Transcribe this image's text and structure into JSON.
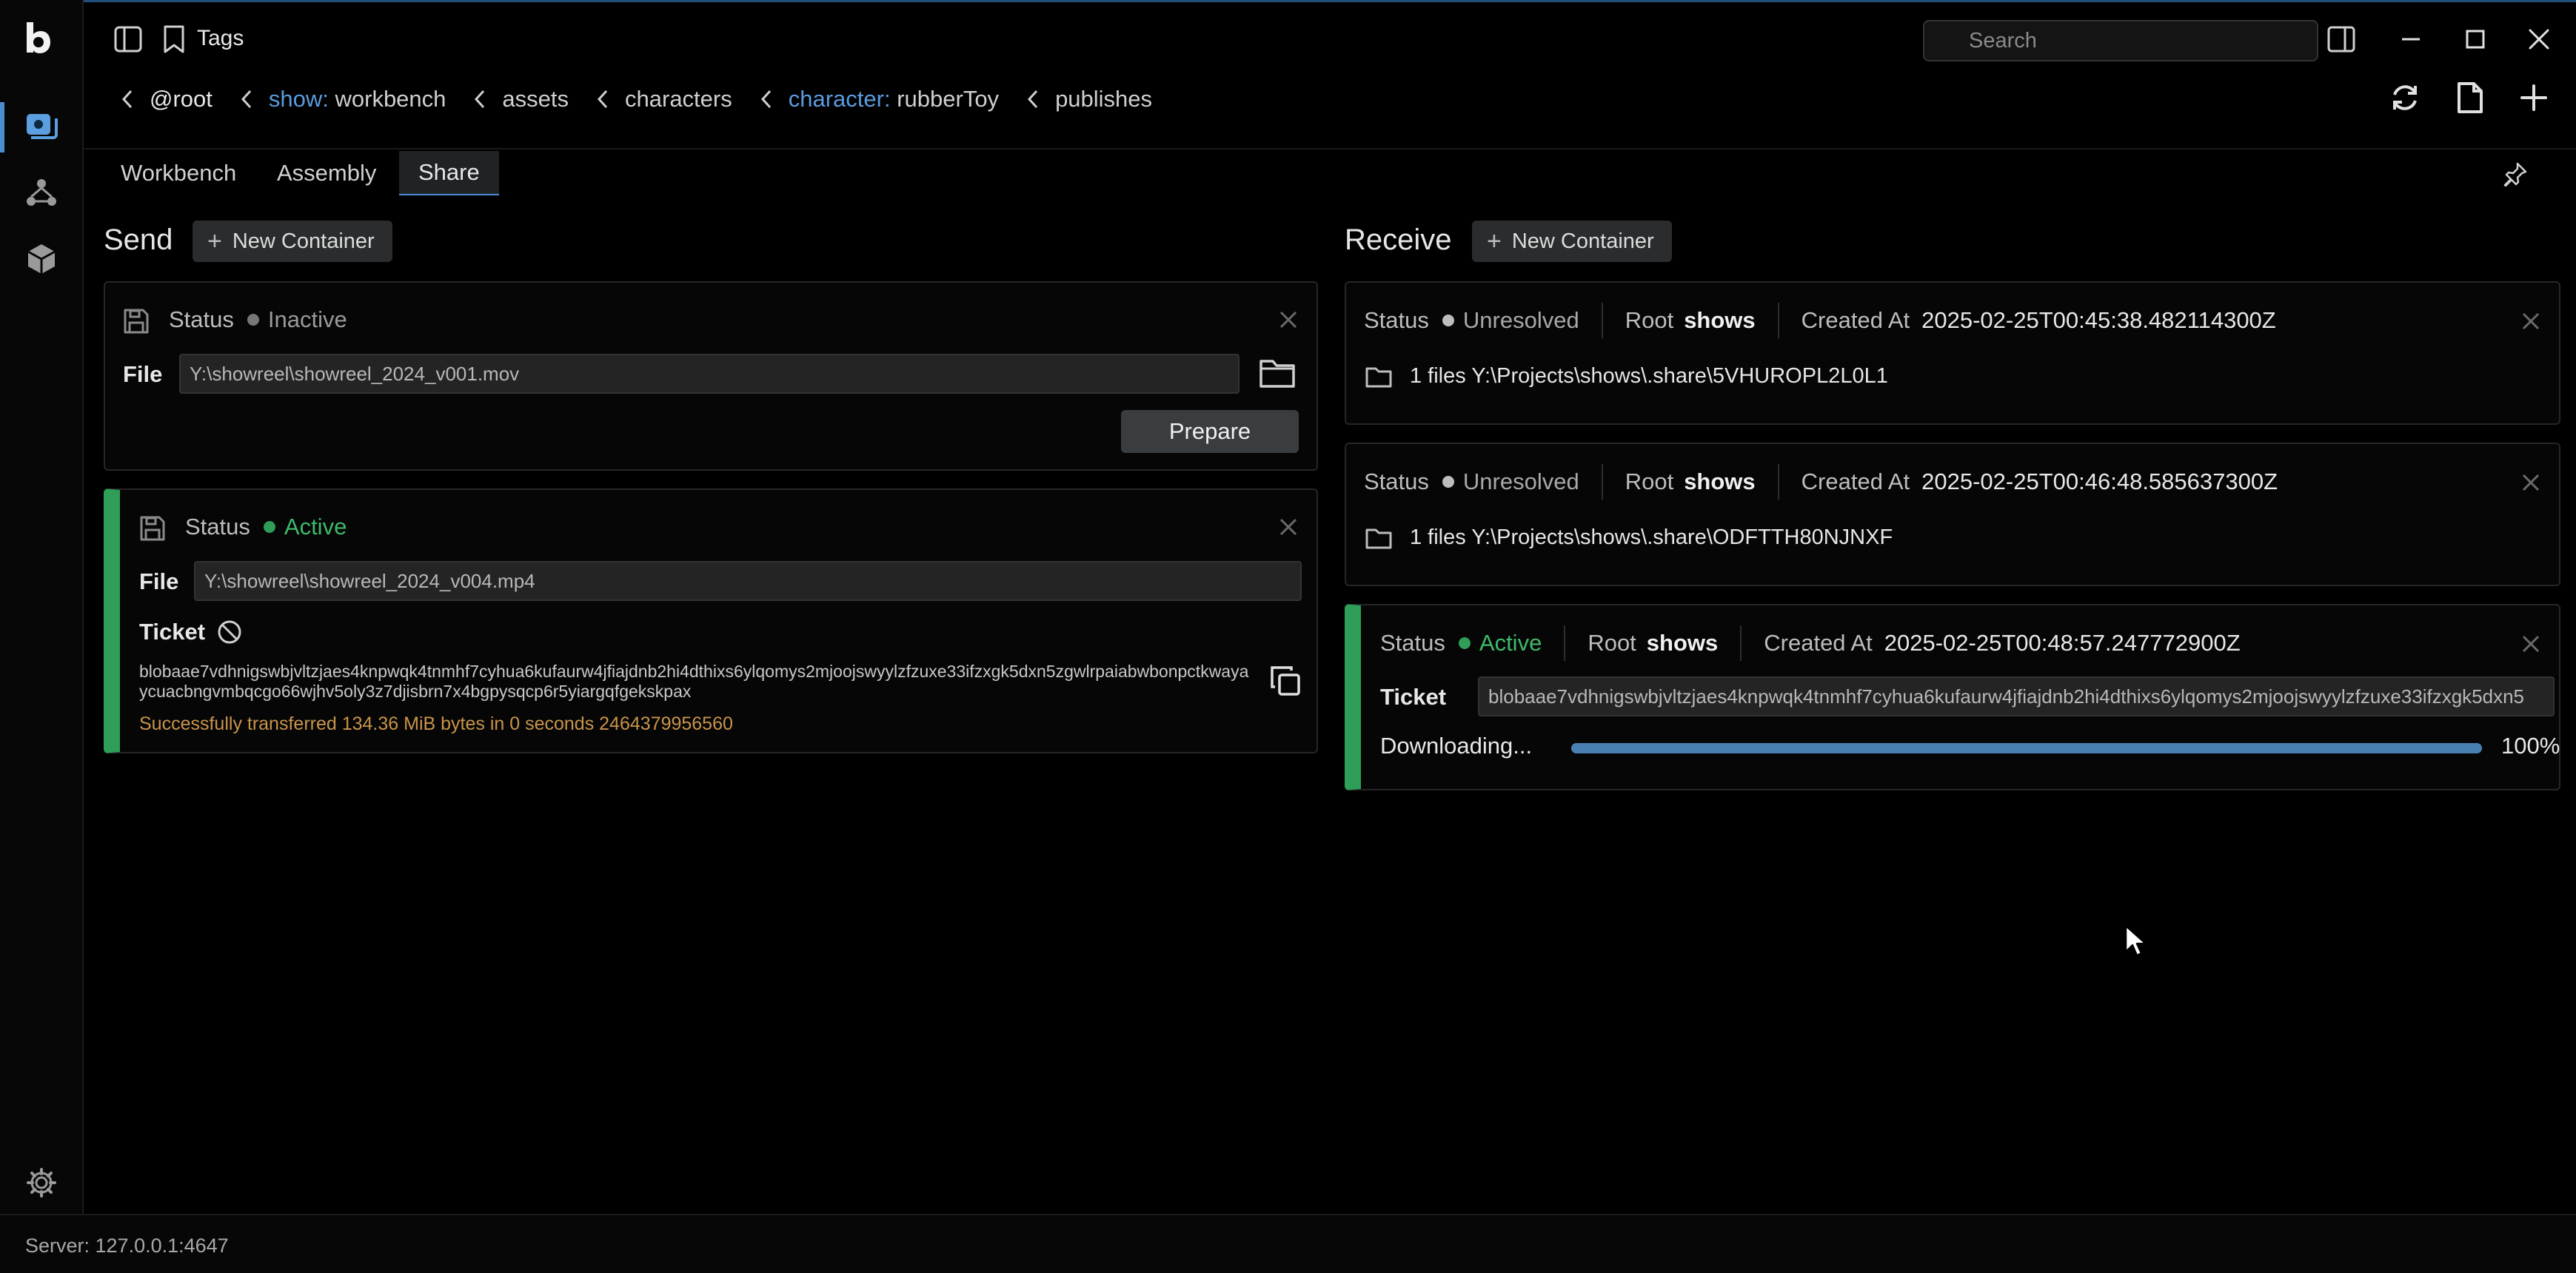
{
  "titlebar": {
    "title": "Tags",
    "search_placeholder": "Search"
  },
  "breadcrumb": [
    {
      "label": "@root",
      "key": ""
    },
    {
      "label": " workbench",
      "key": "show:"
    },
    {
      "label": "assets",
      "key": ""
    },
    {
      "label": "characters",
      "key": ""
    },
    {
      "label": " rubberToy",
      "key": "character:"
    },
    {
      "label": "publishes",
      "key": ""
    }
  ],
  "tabs": [
    {
      "label": "Workbench"
    },
    {
      "label": "Assembly"
    },
    {
      "label": "Share"
    }
  ],
  "send": {
    "title": "Send",
    "new_button": "New Container",
    "cards": [
      {
        "status_label": "Status",
        "status": "Inactive",
        "file_label": "File",
        "file": "Y:\\showreel\\showreel_2024_v001.mov",
        "prepare_label": "Prepare"
      },
      {
        "status_label": "Status",
        "status": "Active",
        "file_label": "File",
        "file": "Y:\\showreel\\showreel_2024_v004.mp4",
        "ticket_label": "Ticket",
        "ticket": "blobaae7vdhnigswbjvltzjaes4knpwqk4tnmhf7cyhua6kufaurw4jfiajdnb2hi4dthixs6ylqomys2mjoojswyylzfzuxe33ifzxgk5dxn5zgwlrpaiabwbonpctkwayaycuacbngvmbqcgo66wjhv5oly3z7djisbrn7x4bgpysqcp6r5yiargqfgekskpax",
        "success": "Successfully transferred 134.36 MiB bytes in 0 seconds 2464379956560"
      }
    ]
  },
  "receive": {
    "title": "Receive",
    "new_button": "New Container",
    "cards": [
      {
        "status_label": "Status",
        "status": "Unresolved",
        "root_label": "Root",
        "root": "shows",
        "created_label": "Created At",
        "created": "2025-02-25T00:45:38.482114300Z",
        "files": "1 files Y:\\Projects\\shows\\.share\\5VHUROPL2L0L1"
      },
      {
        "status_label": "Status",
        "status": "Unresolved",
        "root_label": "Root",
        "root": "shows",
        "created_label": "Created At",
        "created": "2025-02-25T00:46:48.585637300Z",
        "files": "1 files Y:\\Projects\\shows\\.share\\ODFTTH80NJNXF"
      },
      {
        "status_label": "Status",
        "status": "Active",
        "root_label": "Root",
        "root": "shows",
        "created_label": "Created At",
        "created": "2025-02-25T00:48:57.247772900Z",
        "ticket_label": "Ticket",
        "ticket": "blobaae7vdhnigswbjvltzjaes4knpwqk4tnmhf7cyhua6kufaurw4jfiajdnb2hi4dthixs6ylqomys2mjoojswyylzfzuxe33ifzxgk5dxn5",
        "downloading_label": "Downloading...",
        "progress_text": "100%",
        "progress": 1.0
      }
    ]
  },
  "statusbar": {
    "server": "Server: 127.0.0.1:4647"
  },
  "colors": {
    "accent": "#4a8cd0",
    "active": "#2f9e58",
    "warning_text": "#c9944a",
    "breadcrumb_key": "#5a9be0"
  }
}
